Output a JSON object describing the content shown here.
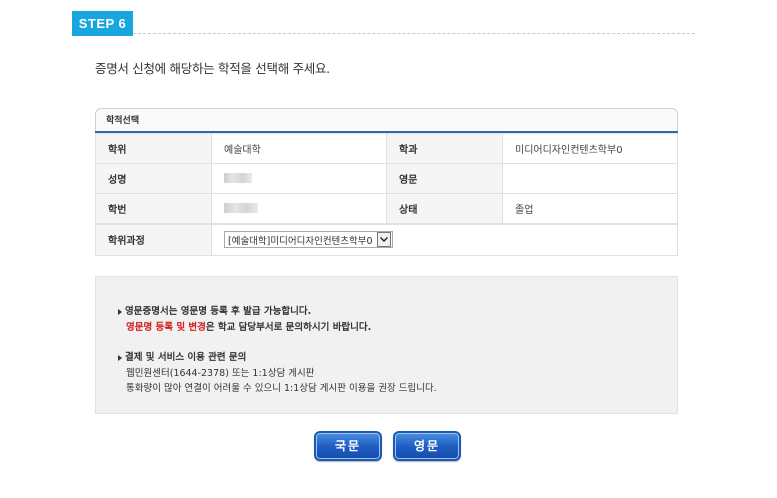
{
  "step_badge": "STEP 6",
  "instruction": "증명서 신청에 해당하는 학적을 선택해 주세요.",
  "panel": {
    "title": "학적선택",
    "rows": [
      {
        "label1": "학위",
        "value1": "예술대학",
        "label2": "학과",
        "value2": "미디어디자인컨텐츠학부0"
      },
      {
        "label1": "성명",
        "value1": "",
        "label2": "영문",
        "value2": ""
      },
      {
        "label1": "학번",
        "value1": "",
        "label2": "상태",
        "value2": "졸업"
      }
    ],
    "course_label": "학위과정",
    "course_select_value": "[예술대학]미디어디자인컨텐츠학부0"
  },
  "notice": {
    "line1": "영문증명서는 영문명 등록 후 발급 가능합니다.",
    "line2_red": "영문명 등록 및 변경",
    "line2_rest": "은 학교 담당부서로 문의하시기 바랍니다.",
    "line3": "결제 및 서비스 이용 관련 문의",
    "line4": "웹민원센터(1644-2378) 또는 1:1상담 게시판",
    "line5": "통화량이 많아 연결이 어려울 수 있으니 1:1상담 게시판 이용을 권장 드립니다."
  },
  "buttons": {
    "korean": "국문",
    "english": "영문"
  },
  "colors": {
    "badge": "#19a5dd",
    "accent_line": "#2a6bb3",
    "button": "#1d5bc0",
    "notice_red": "#d21c1c"
  }
}
